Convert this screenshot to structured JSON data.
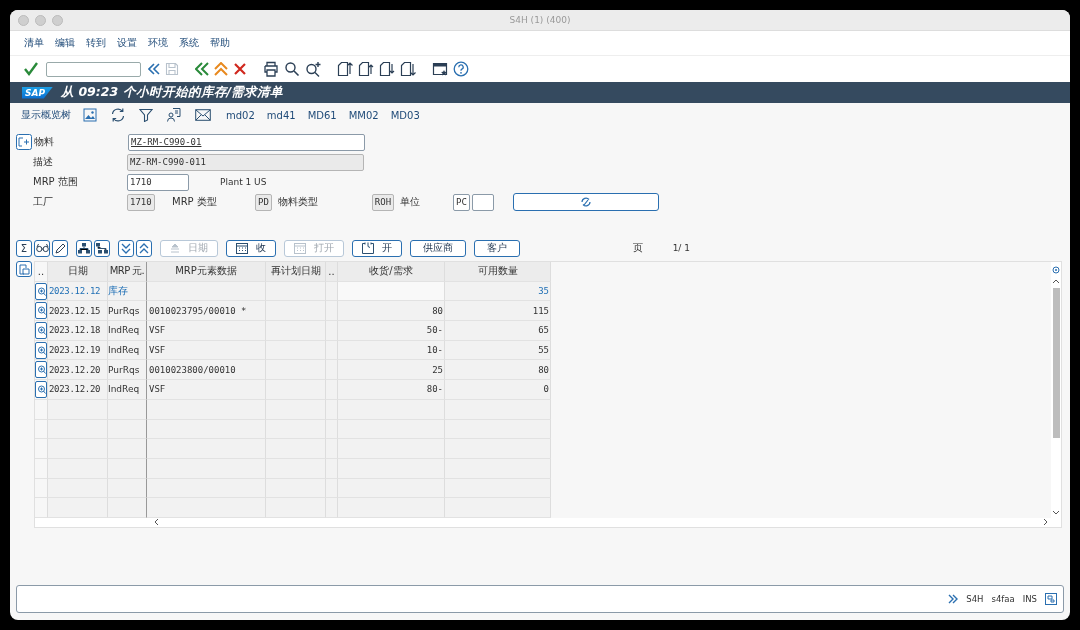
{
  "window": {
    "title": "S4H (1) (400)"
  },
  "menu": [
    "清单",
    "编辑",
    "转到",
    "设置",
    "环境",
    "系统",
    "帮助"
  ],
  "header": {
    "logo": "SAP",
    "title": "从 09:23 个小时开始的库存/需求清单"
  },
  "app_toolbar": {
    "label": "显示概览树",
    "links": [
      "md02",
      "md41",
      "MD61",
      "MM02",
      "MD03"
    ]
  },
  "form": {
    "material": {
      "label": "物料",
      "value": "MZ-RM-C990-01"
    },
    "description": {
      "label": "描述",
      "value": "MZ-RM-C990-011"
    },
    "mrp_area": {
      "label": "MRP 范围",
      "value": "1710",
      "text": "Plant 1 US"
    },
    "plant": {
      "label": "工厂",
      "value": "1710"
    },
    "mrp_type": {
      "label": "MRP 类型",
      "value": "PD"
    },
    "material_type": {
      "label": "物料类型",
      "value": "ROH"
    },
    "unit": {
      "label": "单位",
      "value": "PC"
    }
  },
  "table_toolbar": {
    "sum_icon": "Σ",
    "buttons": [
      {
        "label": "日期",
        "kind": "sort",
        "disabled": true
      },
      {
        "label": "收",
        "kind": "calendar",
        "disabled": false
      },
      {
        "label": "打开",
        "kind": "calendar",
        "disabled": true
      },
      {
        "label": "开",
        "kind": "clock",
        "disabled": false
      },
      {
        "label": "供应商",
        "kind": "text",
        "disabled": false
      },
      {
        "label": "客户",
        "kind": "text",
        "disabled": false
      }
    ],
    "page_label": "页",
    "page": "1/ 1"
  },
  "table": {
    "columns": [
      "..",
      "日期",
      "MRP 元.",
      "MRP元素数据",
      "再计划日期",
      "..",
      "收货/需求",
      "可用数量"
    ],
    "rows": [
      {
        "date": "2023.12.12",
        "element": "库存",
        "data": "",
        "receipt": "",
        "available": "35",
        "emphasized": true
      },
      {
        "date": "2023.12.15",
        "element": "PurRqs",
        "data": "0010023795/00010 *",
        "receipt": "80",
        "available": "115",
        "emphasized": false
      },
      {
        "date": "2023.12.18",
        "element": "IndReq",
        "data": "VSF",
        "receipt": "50-",
        "available": "65",
        "emphasized": false
      },
      {
        "date": "2023.12.19",
        "element": "IndReq",
        "data": "VSF",
        "receipt": "10-",
        "available": "55",
        "emphasized": false
      },
      {
        "date": "2023.12.20",
        "element": "PurRqs",
        "data": "0010023800/00010",
        "receipt": "25",
        "available": "80",
        "emphasized": false
      },
      {
        "date": "2023.12.20",
        "element": "IndReq",
        "data": "VSF",
        "receipt": "80-",
        "available": "0",
        "emphasized": false
      }
    ]
  },
  "status_bar": [
    "S4H",
    "s4faa",
    "INS"
  ]
}
